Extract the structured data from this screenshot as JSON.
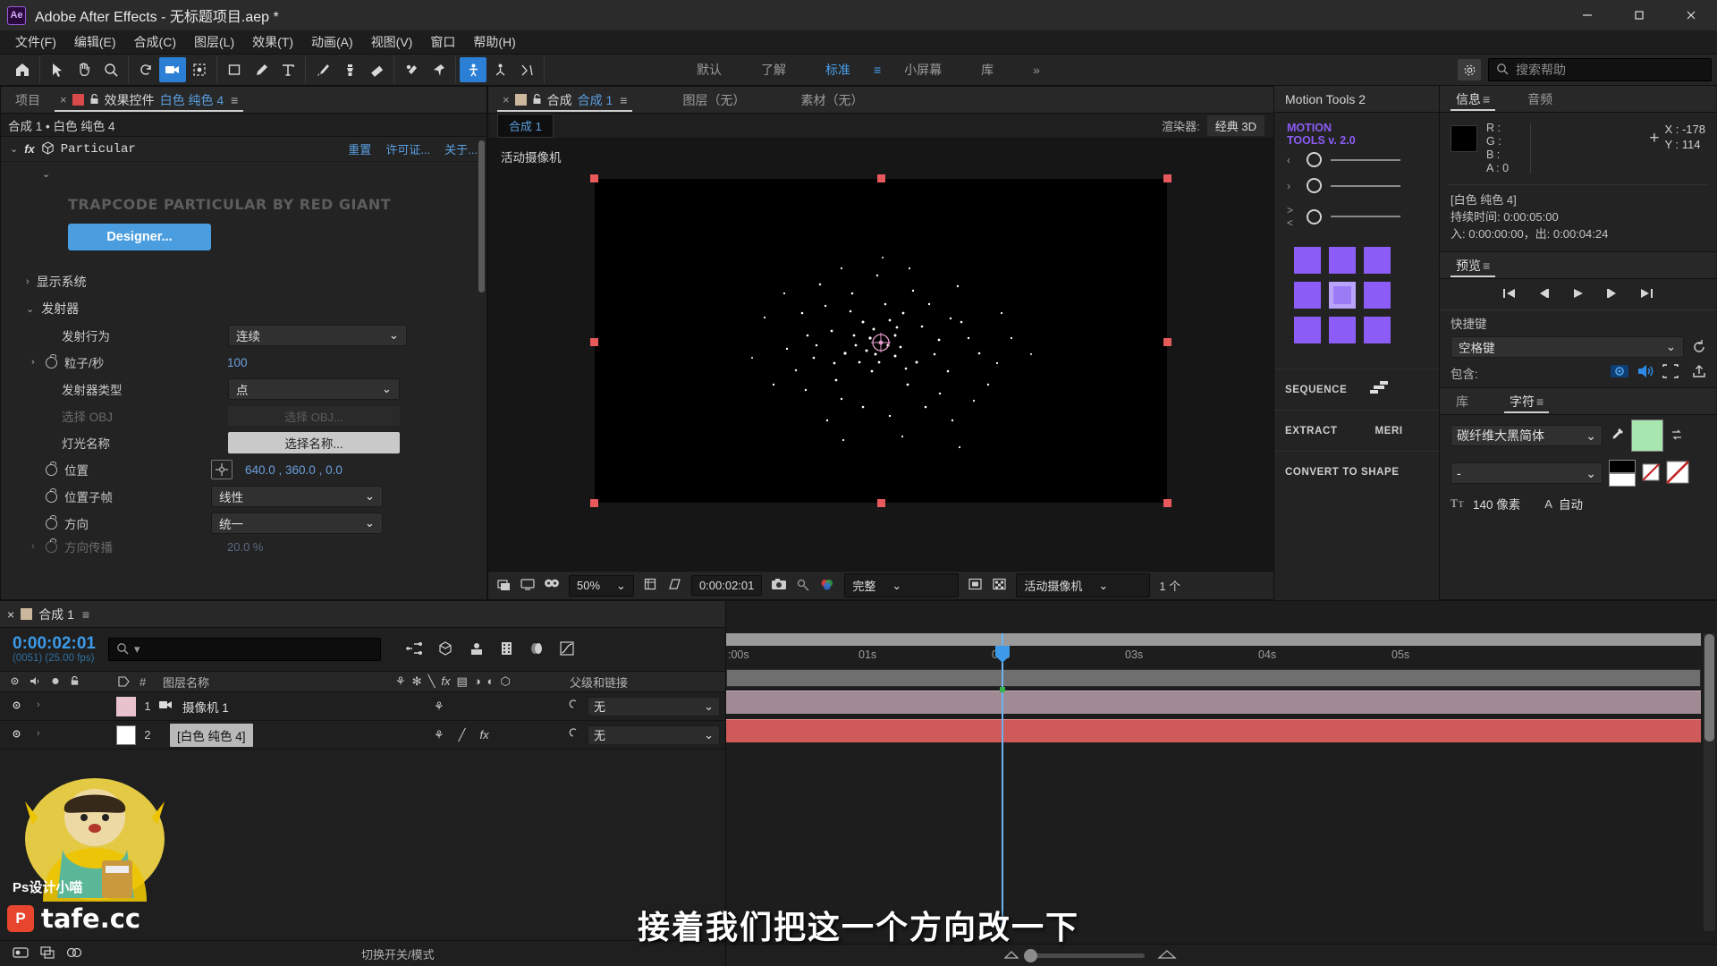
{
  "titlebar": {
    "app_icon": "ae-logo",
    "title": "Adobe After Effects - 无标题项目.aep *",
    "minimize": "—",
    "maximize": "❐",
    "close": "✕"
  },
  "menubar": {
    "items": [
      {
        "label": "文件(F)"
      },
      {
        "label": "编辑(E)"
      },
      {
        "label": "合成(C)"
      },
      {
        "label": "图层(L)"
      },
      {
        "label": "效果(T)"
      },
      {
        "label": "动画(A)"
      },
      {
        "label": "视图(V)"
      },
      {
        "label": "窗口"
      },
      {
        "label": "帮助(H)"
      }
    ]
  },
  "toolbar": {
    "workspaces": [
      {
        "label": "默认",
        "selected": false
      },
      {
        "label": "了解",
        "selected": false
      },
      {
        "label": "标准",
        "selected": true
      },
      {
        "label": "小屏幕",
        "selected": false
      },
      {
        "label": "库",
        "selected": false
      }
    ],
    "overflow": "»",
    "search_placeholder": "搜索帮助"
  },
  "effect_controls": {
    "tab_project": "项目",
    "tab_close": "×",
    "tab_effect_controls": "效果控件",
    "tab_layer_name": "白色 纯色 4",
    "subtitle": "合成 1 • 白色 纯色 4",
    "effect_name": "Particular",
    "links": [
      "重置",
      "许可证...",
      "关于..."
    ],
    "brand": "TRAPCODE PARTICULAR BY RED GIANT",
    "designer_button": "Designer...",
    "sections": [
      {
        "label": "显示系统",
        "expanded": false
      },
      {
        "label": "发射器",
        "expanded": true
      }
    ],
    "properties": [
      {
        "label": "发射行为",
        "value": "连续",
        "type": "select",
        "dim": false,
        "stopwatch": false
      },
      {
        "label": "粒子/秒",
        "value": "100",
        "type": "number",
        "dim": false,
        "stopwatch": true
      },
      {
        "label": "发射器类型",
        "value": "点",
        "type": "select",
        "dim": false,
        "stopwatch": false
      },
      {
        "label": "选择 OBJ",
        "value": "选择 OBJ...",
        "type": "button",
        "dim": true,
        "stopwatch": false
      },
      {
        "label": "灯光名称",
        "value": "选择名称...",
        "type": "pickbutton",
        "dim": false,
        "stopwatch": false
      },
      {
        "label": "位置",
        "value": "640.0 , 360.0 , 0.0",
        "type": "xyz",
        "dim": false,
        "stopwatch": true
      },
      {
        "label": "位置子帧",
        "value": "线性",
        "type": "select",
        "dim": false,
        "stopwatch": true
      },
      {
        "label": "方向",
        "value": "统一",
        "type": "select",
        "dim": false,
        "stopwatch": true
      },
      {
        "label": "方向传播",
        "value": "20.0 %",
        "type": "number",
        "dim": true,
        "stopwatch": true
      }
    ]
  },
  "composition": {
    "tab_close": "×",
    "tab_label": "合成",
    "tab_name": "合成 1",
    "tab_layer": "图层（无）",
    "tab_footage": "素材（无）",
    "comp_chip": "合成 1",
    "renderer_label": "渲染器:",
    "renderer_value": "经典 3D",
    "camera_label": "活动摄像机",
    "bottom_bar": {
      "zoom": "50%",
      "timecode": "0:00:02:01",
      "quality": "完整",
      "view": "活动摄像机",
      "views_count": "1 个"
    }
  },
  "motion_tools": {
    "title": "Motion Tools 2",
    "logo_line1": "MOTION",
    "logo_line2": "TOOLS v. 2.0",
    "buttons": [
      "SEQUENCE",
      "EXTRACT",
      "MERI",
      "CONVERT TO SHAPE"
    ]
  },
  "info_panel": {
    "tabs": [
      {
        "label": "信息",
        "selected": true
      },
      {
        "label": "音频",
        "selected": false
      }
    ],
    "r": "R :",
    "g": "G :",
    "b": "B :",
    "a": "A : 0",
    "x": "X : -178",
    "y": "Y : 114",
    "layer": "[白色 纯色 4]",
    "duration": "持续时间: 0:00:05:00",
    "inout": "入: 0:00:00:00，出: 0:00:04:24"
  },
  "preview_panel": {
    "title": "预览",
    "shortcut_label": "快捷键",
    "shortcut_value": "空格键",
    "include_label": "包含:"
  },
  "character_panel": {
    "tabs": [
      {
        "label": "库",
        "selected": false
      },
      {
        "label": "字符",
        "selected": true
      }
    ],
    "font_family": "碳纤维大黑简体",
    "font_style": "-",
    "font_size": "140 像素",
    "leading": "自动"
  },
  "timeline": {
    "tab_name": "合成 1",
    "current_time": "0:00:02:01",
    "frame_info": "(0051) (25.00 fps)",
    "search_placeholder": "",
    "columns": {
      "number": "#",
      "layer_name": "图层名称",
      "parent": "父级和链接"
    },
    "layers": [
      {
        "index": "1",
        "name": "摄像机 1",
        "parent": "无",
        "color": "#e8c2cc",
        "selected": false,
        "clip_color": "#a08b95"
      },
      {
        "index": "2",
        "name": "[白色 纯色 4]",
        "parent": "无",
        "color": "#ffffff",
        "selected": true,
        "clip_color": "#cf5a5a"
      }
    ],
    "ruler_marks": [
      ":00s",
      "01s",
      "02s",
      "03s",
      "04s",
      "05s"
    ],
    "switches_label": "切换开关/模式"
  },
  "overlays": {
    "subtitle": "接着我们把这一个方向改一下",
    "watermark_brand": "tafe.cc",
    "watermark_badge": "P",
    "watermark_caption": "Ps设计小喵"
  }
}
